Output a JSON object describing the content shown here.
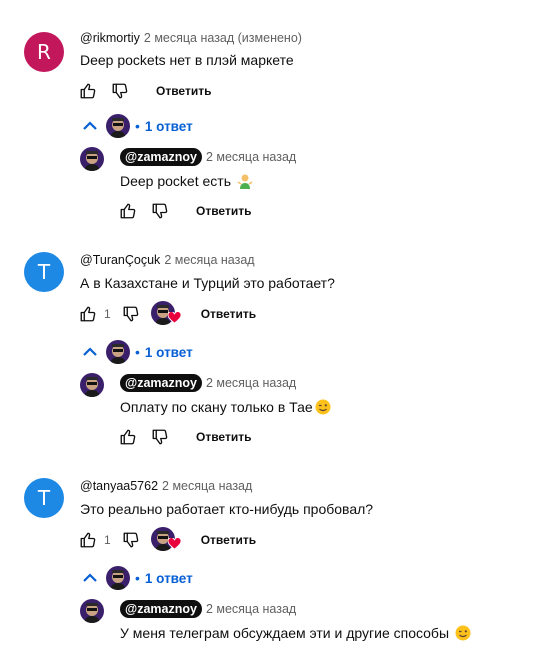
{
  "threads": [
    {
      "avatar_letter": "R",
      "avatar_color": "#c2185b",
      "author": "@rikmortiy",
      "time": "2 месяца назад (изменено)",
      "text": "Deep pockets нет в плэй маркете",
      "likes": "",
      "reply_label": "Ответить",
      "replies_toggle": "1 ответ",
      "reply": {
        "author": "@zamaznoy",
        "time": "2 месяца назад",
        "text": "Deep pocket есть",
        "emoji": "person-shrugging-emoji",
        "reply_label": "Ответить"
      }
    },
    {
      "avatar_letter": "T",
      "avatar_color": "#1e88e5",
      "author": "@TuranÇoçuk",
      "time": "2 месяца назад",
      "text": "А в Казахстане и Турций это работает?",
      "likes": "1",
      "reply_label": "Ответить",
      "replies_toggle": "1 ответ",
      "reply": {
        "author": "@zamaznoy",
        "time": "2 месяца назад",
        "text": "Оплату по скану только в Тае",
        "emoji": "winking-face-emoji",
        "reply_label": "Ответить"
      }
    },
    {
      "avatar_letter": "T",
      "avatar_color": "#1e88e5",
      "author": "@tanyaa5762",
      "time": "2 месяца назад",
      "text": "Это реально работает кто-нибудь пробовал?",
      "likes": "1",
      "reply_label": "Ответить",
      "replies_toggle": "1 ответ",
      "reply": {
        "author": "@zamaznoy",
        "time": "2 месяца назад",
        "text": "У меня телеграм обсуждаем эти и другие способы",
        "emoji": "winking-face-emoji",
        "reply_label": ""
      }
    }
  ]
}
